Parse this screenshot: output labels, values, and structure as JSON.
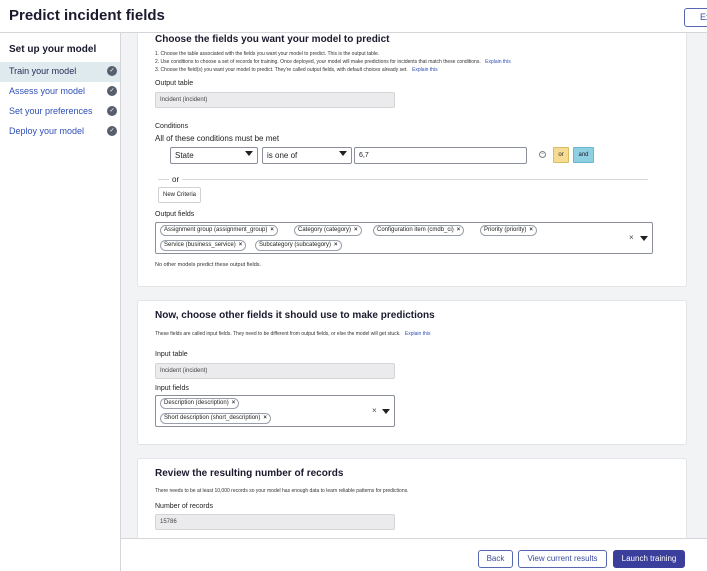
{
  "header": {
    "title": "Predict incident fields",
    "exit_label": "Exit"
  },
  "sidebar": {
    "heading": "Set up your model",
    "items": [
      {
        "label": "Train your model",
        "active": true
      },
      {
        "label": "Assess your model",
        "active": false
      },
      {
        "label": "Set your preferences",
        "active": false
      },
      {
        "label": "Deploy your model",
        "active": false
      }
    ]
  },
  "section1": {
    "title": "Choose the fields you want your model to predict",
    "instructions": [
      "1. Choose the table associated with the fields you want your model to predict. This is the output table.",
      "2. Use conditions to choose a set of records for training. Once deployed, your model will make predictions for incidents that match these conditions.",
      "3. Choose the field(s) you want your model to predict. They're called output fields, with default choices already set."
    ],
    "explain_link": "Explain this",
    "output_table_label": "Output table",
    "output_table_value": "Incident (incident)",
    "conditions_label": "Conditions",
    "conditions_subtitle": "All of these conditions must be met",
    "condition": {
      "field": "State",
      "operator": "is one of",
      "value": "6,7"
    },
    "or_button": "or",
    "and_button": "and",
    "or_separator": "or",
    "new_criteria_button": "New Criteria",
    "output_fields_label": "Output fields",
    "output_fields": [
      "Assignment group (assignment_group)",
      "Category (category)",
      "Configuration item (cmdb_ci)",
      "Priority (priority)",
      "Service (business_service)",
      "Subcategory (subcategory)"
    ],
    "tag_remove": "×",
    "clear_all": "×",
    "note": "No other models predict these output fields."
  },
  "section2": {
    "title": "Now, choose other fields it should use to make predictions",
    "description": "These fields are called input fields. They need to be different from output fields, or else the model will get stuck.",
    "explain_link": "Explain this",
    "input_table_label": "Input table",
    "input_table_value": "Incident (incident)",
    "input_fields_label": "Input fields",
    "input_fields": [
      "Description (description)",
      "Short description (short_description)"
    ],
    "tag_remove": "×",
    "clear_all": "×"
  },
  "section3": {
    "title": "Review the resulting number of records",
    "description": "There needs to be at least 10,000 records so your model has enough data to learn reliable patterns for predictions.",
    "records_label": "Number of records",
    "records_value": "15786"
  },
  "footer": {
    "back_label": "Back",
    "view_results_label": "View current results",
    "launch_label": "Launch training"
  },
  "colors": {
    "primary": "#3a3f9c",
    "link": "#2e4fb5",
    "active_nav_bg": "#dfeaee",
    "or_button_bg": "#f5dc92",
    "and_button_bg": "#8ed0e2"
  }
}
